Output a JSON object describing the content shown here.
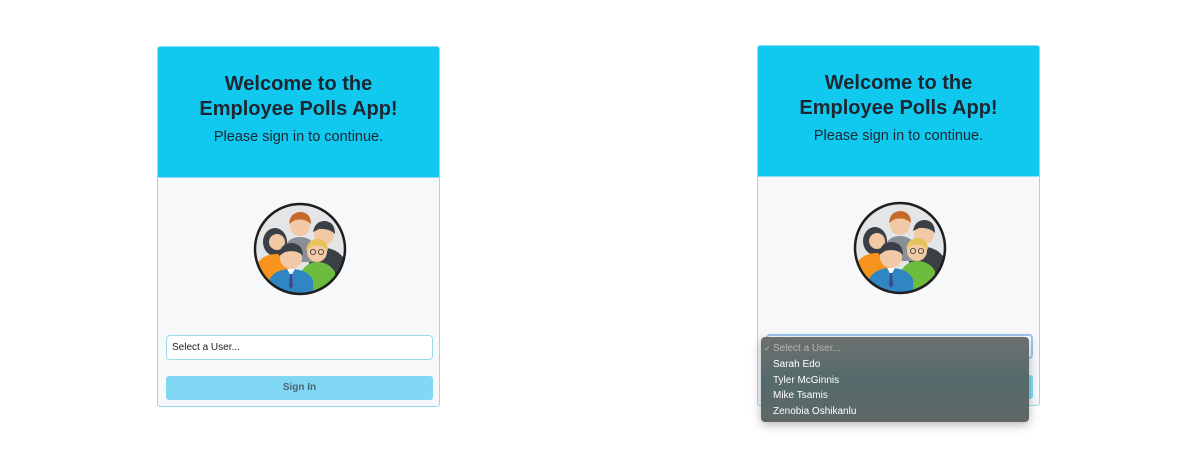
{
  "colors": {
    "header_bg": "#11c9ef",
    "card_bg": "#f7f8fa",
    "button_bg": "#80d8f4",
    "dropdown_bg": "#5f6a69"
  },
  "icons": {
    "avatar": "group-of-employees-icon",
    "check": "checkmark-icon"
  },
  "login_card": {
    "title_line1": "Welcome to the",
    "title_line2": "Employee Polls App!",
    "subtitle": "Please sign in to continue.",
    "select_placeholder": "Select a User...",
    "sign_in_label": "Sign In"
  },
  "login_card_open": {
    "title_line1": "Welcome to the",
    "title_line2": "Employee Polls App!",
    "subtitle": "Please sign in to continue."
  },
  "dropdown": {
    "check_glyph": "✓",
    "placeholder": "Select a User...",
    "options": [
      {
        "label": "Sarah Edo"
      },
      {
        "label": "Tyler McGinnis"
      },
      {
        "label": "Mike Tsamis"
      },
      {
        "label": "Zenobia Oshikanlu"
      }
    ]
  }
}
